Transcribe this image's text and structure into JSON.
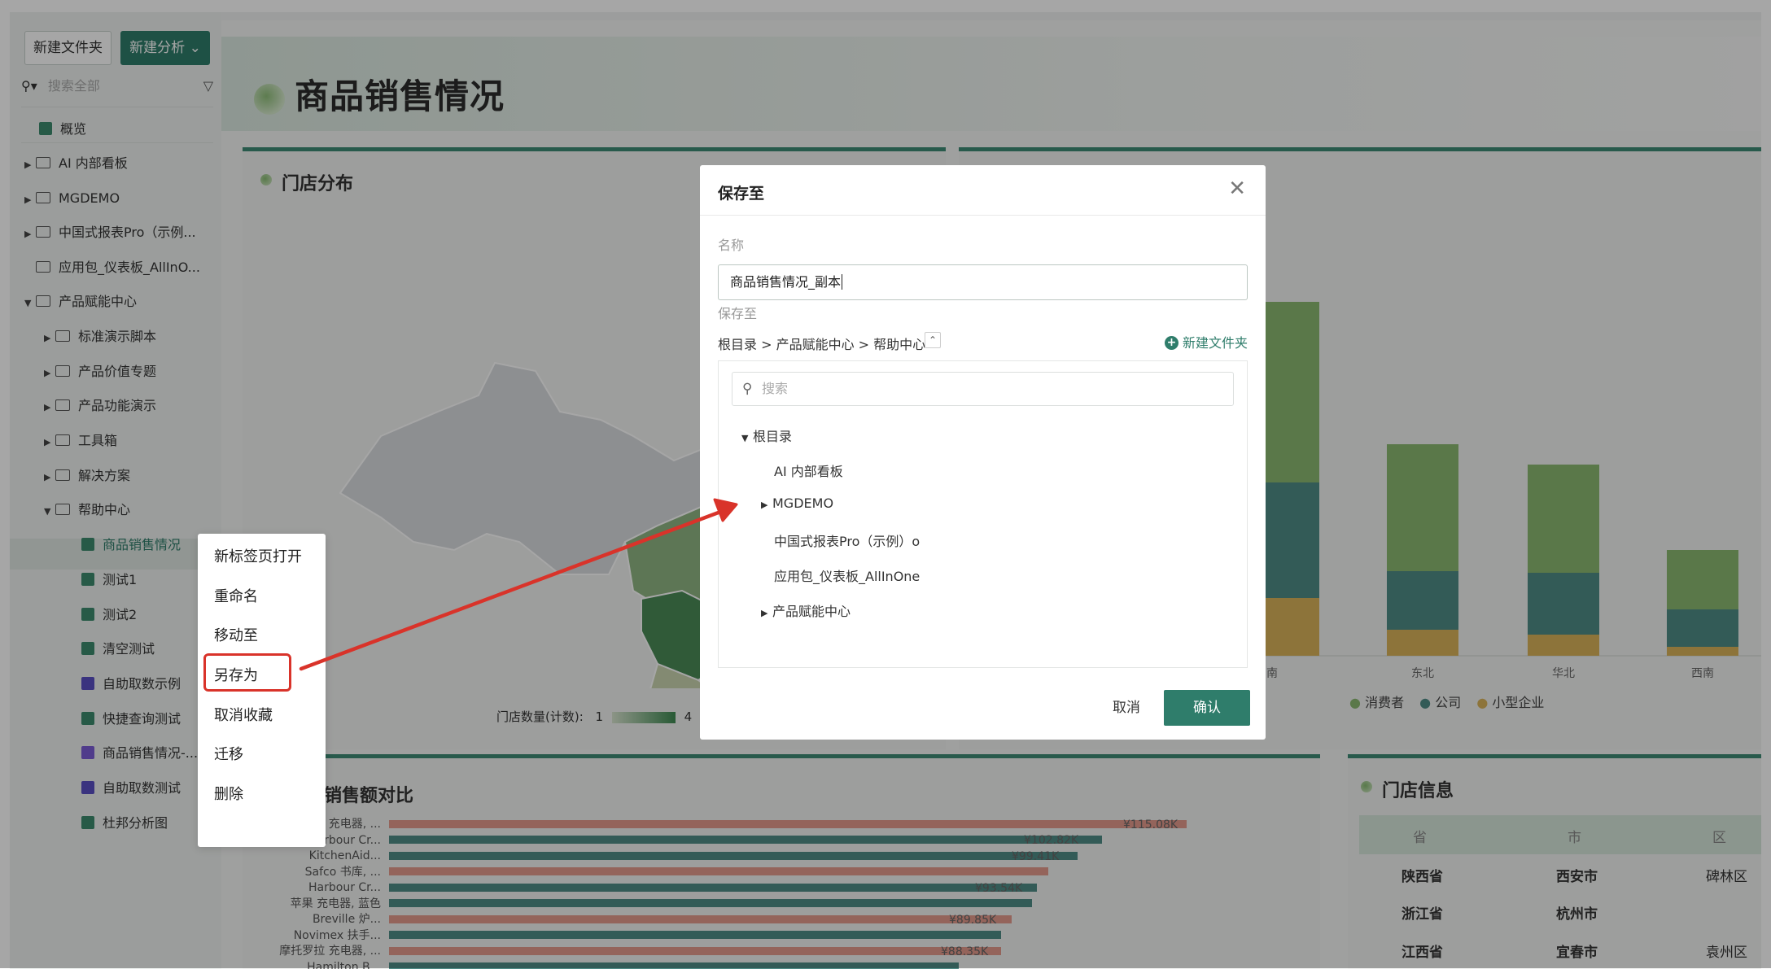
{
  "sidebar": {
    "new_folder_btn": "新建文件夹",
    "new_analysis_btn": "新建分析",
    "search_placeholder": "搜索全部",
    "items": [
      {
        "label": "概览"
      },
      {
        "label": "AI 内部看板"
      },
      {
        "label": "MGDEMO"
      },
      {
        "label": "中国式报表Pro（示例..."
      },
      {
        "label": "应用包_仪表板_AllInO..."
      },
      {
        "label": "产品赋能中心"
      },
      {
        "label": "标准演示脚本"
      },
      {
        "label": "产品价值专题"
      },
      {
        "label": "产品功能演示"
      },
      {
        "label": "工具箱"
      },
      {
        "label": "解决方案"
      },
      {
        "label": "帮助中心"
      },
      {
        "label": "商品销售情况"
      },
      {
        "label": "测试1"
      },
      {
        "label": "测试2"
      },
      {
        "label": "清空测试"
      },
      {
        "label": "自助取数示例"
      },
      {
        "label": "快捷查询测试"
      },
      {
        "label": "商品销售情况-..."
      },
      {
        "label": "自助取数测试"
      },
      {
        "label": "杜邦分析图"
      }
    ]
  },
  "dashboard": {
    "title": "商品销售情况",
    "map_card_title": "门店分布",
    "map_legend_label": "门店数量(计数):",
    "map_legend_min": "1",
    "map_legend_max": "4",
    "bar_card_title": "销售额对比",
    "info_card_title": "门店信息"
  },
  "bar_chart": {
    "categories": [
      "南",
      "东北",
      "华北",
      "西南"
    ],
    "series": [
      {
        "name": "消费者",
        "color": "#8ab870"
      },
      {
        "name": "公司",
        "color": "#4f8c86"
      },
      {
        "name": "小型企业",
        "color": "#d9b25a"
      }
    ]
  },
  "hbar_chart": {
    "labels": [
      "摩托罗拉 充电器, ...",
      "Harbour Cr...",
      "KitchenAid...",
      "Safco 书库, ...",
      "Harbour Cr...",
      "苹果 充电器, 蓝色",
      "Breville 炉...",
      "Novimex 扶手...",
      "摩托罗拉 充电器, ...",
      "Hamilton B..."
    ],
    "value_labels": [
      "¥115.08K",
      "¥102.82K",
      "¥99.41K",
      "¥93.54K",
      "¥89.85K",
      "¥88.35K"
    ]
  },
  "store_table": {
    "headers": [
      "省",
      "市",
      "区"
    ],
    "rows": [
      [
        "陕西省",
        "西安市",
        "碑林区"
      ],
      [
        "浙江省",
        "杭州市",
        ""
      ],
      [
        "江西省",
        "宜春市",
        "袁州区"
      ]
    ]
  },
  "context_menu": {
    "items": [
      "新标签页打开",
      "重命名",
      "移动至",
      "另存为",
      "取消收藏",
      "迁移",
      "删除"
    ]
  },
  "modal": {
    "title": "保存至",
    "name_label": "名称",
    "name_value": "商品销售情况_副本",
    "save_to_label": "保存至",
    "path": "根目录 > 产品赋能中心 > 帮助中心",
    "new_folder_label": "新建文件夹",
    "search_placeholder": "搜索",
    "tree": [
      "根目录",
      "AI 内部看板",
      "MGDEMO",
      "中国式报表Pro（示例）o",
      "应用包_仪表板_AllInOne",
      "产品赋能中心"
    ],
    "cancel_label": "取消",
    "confirm_label": "确认"
  },
  "colors": {
    "accent": "#2f7d6b",
    "highlight": "#d9332a"
  }
}
